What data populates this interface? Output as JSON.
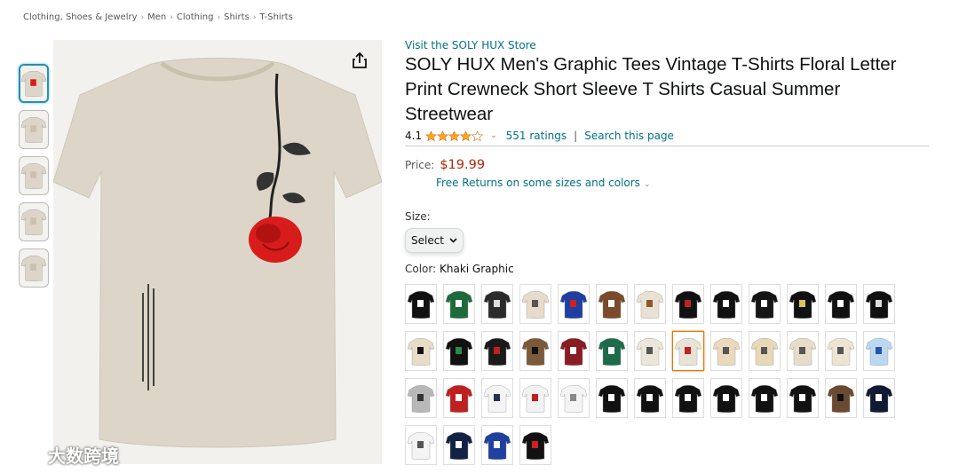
{
  "breadcrumb": [
    "Clothing, Shoes & Jewelry",
    "Men",
    "Clothing",
    "Shirts",
    "T-Shirts"
  ],
  "thumbnails": [
    {
      "icon": "tshirt-front-icon",
      "active": true
    },
    {
      "icon": "tshirt-back-icon",
      "active": false
    },
    {
      "icon": "tshirt-detail-icon",
      "active": false
    },
    {
      "icon": "fabric-fold-icon",
      "active": false
    },
    {
      "icon": "size-chart-icon",
      "active": false
    }
  ],
  "product": {
    "store_link": "Visit the SOLY HUX Store",
    "title": "SOLY HUX Men's Graphic Tees Vintage T-Shirts Floral Letter Print Crewneck Short Sleeve T Shirts Casual Summer Streetwear",
    "rating": "4.1",
    "rating_stars": 4.1,
    "ratings_count": "551 ratings",
    "search_link": "Search this page",
    "price_label": "Price:",
    "price": "$19.99",
    "returns": "Free Returns on some sizes and colors",
    "size_label": "Size:",
    "size_value": "Select",
    "color_label": "Color:",
    "color_value": "Khaki Graphic"
  },
  "colors": {
    "link": "#007185",
    "price": "#b12704",
    "star": "#ffa41c",
    "selected_border": "#e77600"
  },
  "watermark": "大数跨境",
  "swatches": [
    {
      "color": "#111111",
      "print": "#ffffff"
    },
    {
      "color": "#1d6b3a",
      "print": "#ffffff"
    },
    {
      "color": "#2b2b2b",
      "print": "#dddddd"
    },
    {
      "color": "#e7dccb",
      "print": "#555555"
    },
    {
      "color": "#1f3fa0",
      "print": "#d02020"
    },
    {
      "color": "#7a4a2a",
      "print": "#ffffff"
    },
    {
      "color": "#e9e2d4",
      "print": "#8a5a2a"
    },
    {
      "color": "#111111",
      "print": "#c02020"
    },
    {
      "color": "#111111",
      "print": "#ffffff"
    },
    {
      "color": "#151515",
      "print": "#ffffff"
    },
    {
      "color": "#111111",
      "print": "#e0c060"
    },
    {
      "color": "#111111",
      "print": "#ffffff"
    },
    {
      "color": "#111111",
      "print": "#dddddd"
    },
    {
      "color": "#e8dcc6",
      "print": "#111111"
    },
    {
      "color": "#111111",
      "print": "#2c8a4a"
    },
    {
      "color": "#1a1a1a",
      "print": "#c02020"
    },
    {
      "color": "#7a5a3a",
      "print": "#111111"
    },
    {
      "color": "#8a1c24",
      "print": "#ffffff"
    },
    {
      "color": "#1d6b4a",
      "print": "#ffffff"
    },
    {
      "color": "#ece6d8",
      "print": "#555555"
    },
    {
      "color": "#e9e3d6",
      "print": "#c02020"
    },
    {
      "color": "#ead9bc",
      "print": "#555555"
    },
    {
      "color": "#e8d8b8",
      "print": "#555555"
    },
    {
      "color": "#e6ddc8",
      "print": "#555555"
    },
    {
      "color": "#ede4d2",
      "print": "#555555"
    },
    {
      "color": "#bcd8f0",
      "print": "#2255aa"
    },
    {
      "color": "#b8b8b8",
      "print": "#333333"
    },
    {
      "color": "#c02020",
      "print": "#ffffff"
    },
    {
      "color": "#f4f4f4",
      "print": "#223355"
    },
    {
      "color": "#f2f2f2",
      "print": "#c02020"
    },
    {
      "color": "#f4f4f4",
      "print": "#888888"
    },
    {
      "color": "#111111",
      "print": "#ffffff"
    },
    {
      "color": "#111111",
      "print": "#ffffff"
    },
    {
      "color": "#111111",
      "print": "#ffffff"
    },
    {
      "color": "#111111",
      "print": "#ffffff"
    },
    {
      "color": "#111111",
      "print": "#ffffff"
    },
    {
      "color": "#111111",
      "print": "#ffffff"
    },
    {
      "color": "#6a4a32",
      "print": "#111111"
    },
    {
      "color": "#111a33",
      "print": "#ffffff"
    },
    {
      "color": "#f4f4f4",
      "print": "#555555"
    },
    {
      "color": "#112244",
      "print": "#ffffff"
    },
    {
      "color": "#2040a0",
      "print": "#ffffff"
    },
    {
      "color": "#111111",
      "print": "#d02020"
    }
  ],
  "selected_swatch": 20
}
